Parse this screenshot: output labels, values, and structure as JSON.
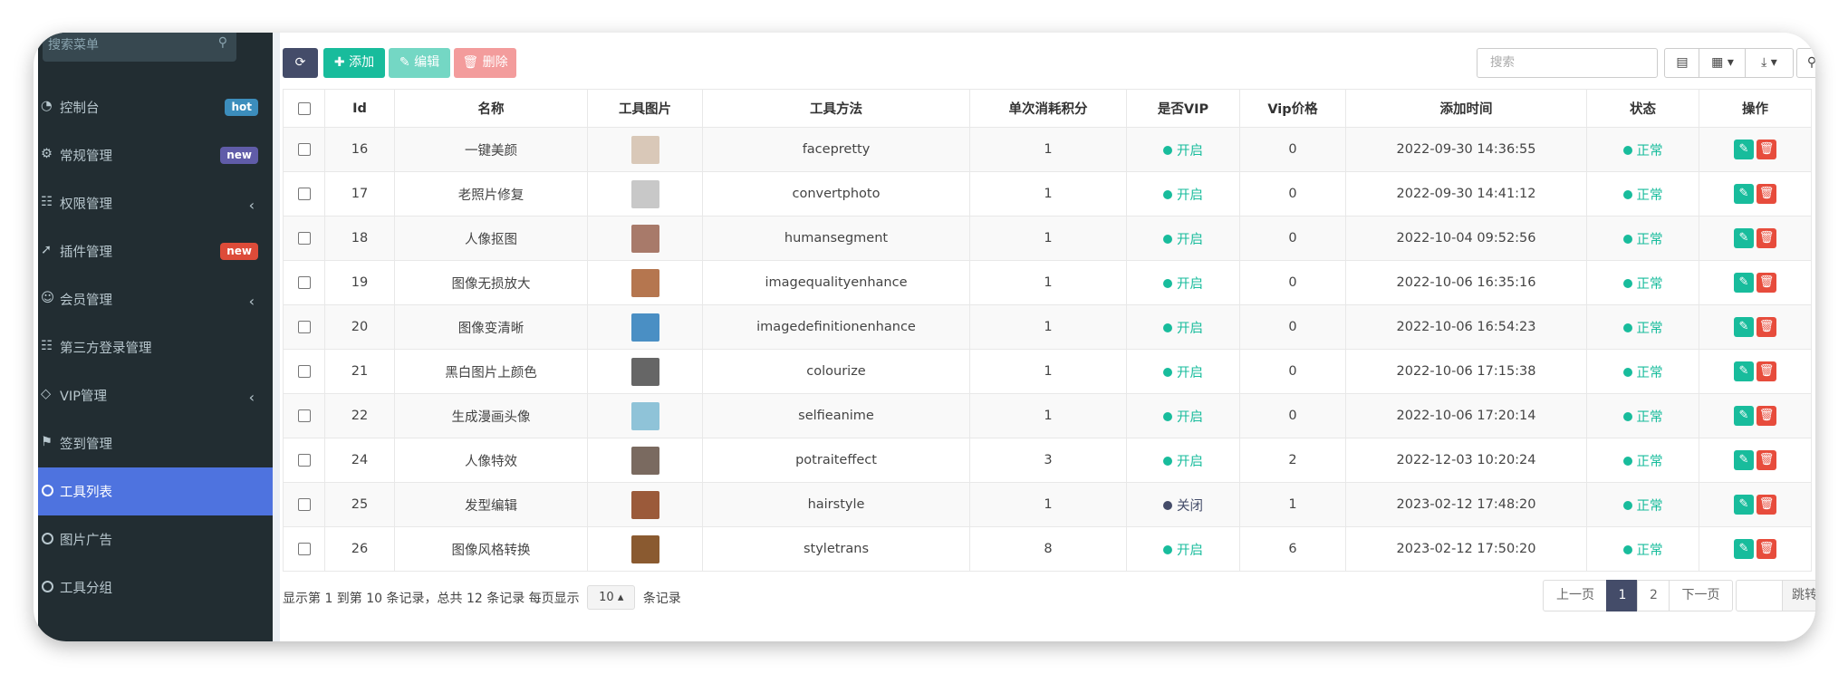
{
  "sidebar": {
    "search_placeholder": "搜索菜单",
    "items": [
      {
        "label": "控制台",
        "icon": "dashboard-icon",
        "badge": "hot",
        "badge_color": "#3c8dbc"
      },
      {
        "label": "常规管理",
        "icon": "cogs-icon",
        "badge": "new",
        "badge_color": "#605ca8"
      },
      {
        "label": "权限管理",
        "icon": "group-icon",
        "chevron": true
      },
      {
        "label": "插件管理",
        "icon": "rocket-icon",
        "badge": "new",
        "badge_color": "#dd4b39"
      },
      {
        "label": "会员管理",
        "icon": "user-circle-icon",
        "chevron": true
      },
      {
        "label": "第三方登录管理",
        "icon": "group-icon"
      },
      {
        "label": "VIP管理",
        "icon": "diamond-icon",
        "chevron": true
      },
      {
        "label": "签到管理",
        "icon": "map-marker-icon"
      },
      {
        "label": "工具列表",
        "icon": "circle-icon",
        "active": true
      },
      {
        "label": "图片广告",
        "icon": "circle-icon"
      },
      {
        "label": "工具分组",
        "icon": "circle-icon"
      }
    ]
  },
  "toolbar": {
    "refresh_icon": "refresh-icon",
    "add_label": "添加",
    "edit_label": "编辑",
    "delete_label": "删除",
    "search_placeholder": "搜索"
  },
  "table": {
    "headers": [
      "Id",
      "名称",
      "工具图片",
      "工具方法",
      "单次消耗积分",
      "是否VIP",
      "Vip价格",
      "添加时间",
      "状态",
      "操作"
    ],
    "rows": [
      {
        "id": "16",
        "name": "一键美颜",
        "method": "facepretty",
        "points": "1",
        "vip": "开启",
        "vip_on": true,
        "price": "0",
        "time": "2022-09-30 14:36:55",
        "status": "正常",
        "thumb": "#d9c8b8"
      },
      {
        "id": "17",
        "name": "老照片修复",
        "method": "convertphoto",
        "points": "1",
        "vip": "开启",
        "vip_on": true,
        "price": "0",
        "time": "2022-09-30 14:41:12",
        "status": "正常",
        "thumb": "#c8c8c8"
      },
      {
        "id": "18",
        "name": "人像抠图",
        "method": "humansegment",
        "points": "1",
        "vip": "开启",
        "vip_on": true,
        "price": "0",
        "time": "2022-10-04 09:52:56",
        "status": "正常",
        "thumb": "#a87a6a"
      },
      {
        "id": "19",
        "name": "图像无损放大",
        "method": "imagequalityenhance",
        "points": "1",
        "vip": "开启",
        "vip_on": true,
        "price": "0",
        "time": "2022-10-06 16:35:16",
        "status": "正常",
        "thumb": "#b5764f"
      },
      {
        "id": "20",
        "name": "图像变清晰",
        "method": "imagedefinitionenhance",
        "points": "1",
        "vip": "开启",
        "vip_on": true,
        "price": "0",
        "time": "2022-10-06 16:54:23",
        "status": "正常",
        "thumb": "#4a8fc4"
      },
      {
        "id": "21",
        "name": "黑白图片上颜色",
        "method": "colourize",
        "points": "1",
        "vip": "开启",
        "vip_on": true,
        "price": "0",
        "time": "2022-10-06 17:15:38",
        "status": "正常",
        "thumb": "#666666"
      },
      {
        "id": "22",
        "name": "生成漫画头像",
        "method": "selfieanime",
        "points": "1",
        "vip": "开启",
        "vip_on": true,
        "price": "0",
        "time": "2022-10-06 17:20:14",
        "status": "正常",
        "thumb": "#8fc3d8"
      },
      {
        "id": "24",
        "name": "人像特效",
        "method": "potraiteffect",
        "points": "3",
        "vip": "开启",
        "vip_on": true,
        "price": "2",
        "time": "2022-12-03 10:20:24",
        "status": "正常",
        "thumb": "#7a6a60"
      },
      {
        "id": "25",
        "name": "发型编辑",
        "method": "hairstyle",
        "points": "1",
        "vip": "关闭",
        "vip_on": false,
        "price": "1",
        "time": "2023-02-12 17:48:20",
        "status": "正常",
        "thumb": "#9b5a3a"
      },
      {
        "id": "26",
        "name": "图像风格转换",
        "method": "styletrans",
        "points": "8",
        "vip": "开启",
        "vip_on": true,
        "price": "6",
        "time": "2023-02-12 17:50:20",
        "status": "正常",
        "thumb": "#8a5a30"
      }
    ]
  },
  "footer": {
    "info_prefix": "显示第 1 到第 10 条记录，总共 12 条记录 每页显示",
    "page_size": "10",
    "info_suffix": "条记录",
    "prev": "上一页",
    "page1": "1",
    "page2": "2",
    "next": "下一页",
    "jump": "跳转"
  },
  "colors": {
    "sidebar_bg": "#222d32",
    "active": "#4e73df",
    "success": "#18bc9c",
    "danger": "#e74c3c",
    "primary_dark": "#444c69"
  }
}
